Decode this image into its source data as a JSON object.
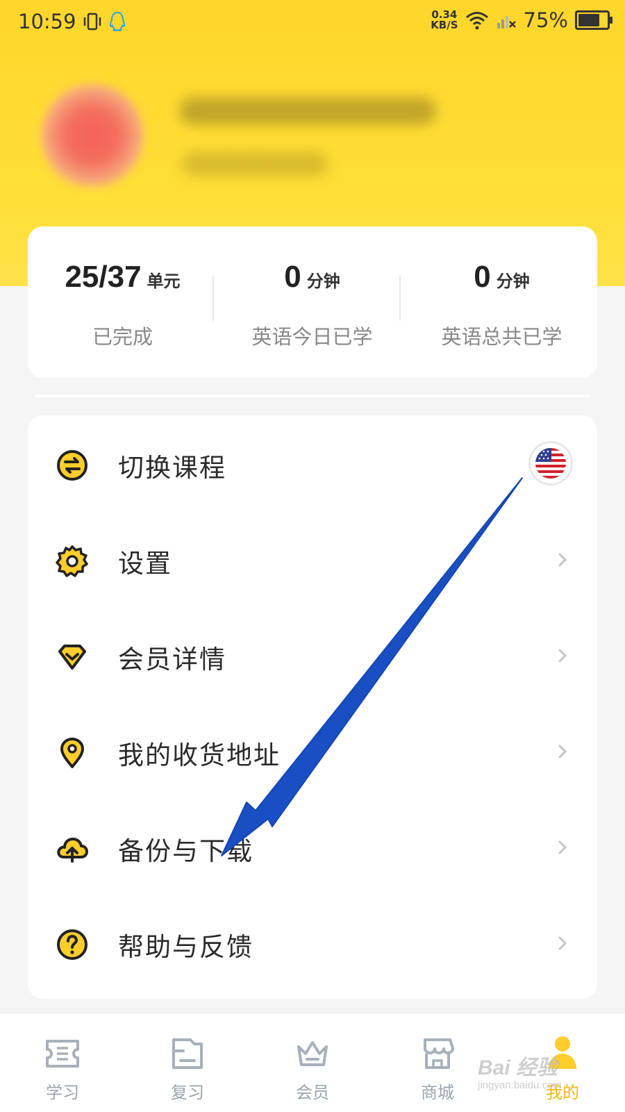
{
  "status_bar": {
    "time": "10:59",
    "net_speed_value": "0.34",
    "net_speed_unit": "KB/S",
    "battery": "75%",
    "battery_level": 0.75
  },
  "stats": [
    {
      "value": "25/37",
      "unit": "单元",
      "label": "已完成"
    },
    {
      "value": "0",
      "unit": "分钟",
      "label": "英语今日已学"
    },
    {
      "value": "0",
      "unit": "分钟",
      "label": "英语总共已学"
    }
  ],
  "menu": [
    {
      "label": "切换课程",
      "icon": "switch-icon",
      "trailing": "us-flag-icon"
    },
    {
      "label": "设置",
      "icon": "gear-icon",
      "trailing": "chevron-right-icon"
    },
    {
      "label": "会员详情",
      "icon": "diamond-icon",
      "trailing": "chevron-right-icon"
    },
    {
      "label": "我的收货地址",
      "icon": "location-pin-icon",
      "trailing": "chevron-right-icon"
    },
    {
      "label": "备份与下载",
      "icon": "cloud-upload-icon",
      "trailing": "chevron-right-icon"
    },
    {
      "label": "帮助与反馈",
      "icon": "question-icon",
      "trailing": "chevron-right-icon"
    }
  ],
  "tabs": [
    {
      "label": "学习",
      "icon": "ticket-icon",
      "active": false
    },
    {
      "label": "复习",
      "icon": "folder-icon",
      "active": false
    },
    {
      "label": "会员",
      "icon": "crown-icon",
      "active": false
    },
    {
      "label": "商城",
      "icon": "store-icon",
      "active": false
    },
    {
      "label": "我的",
      "icon": "person-icon",
      "active": true
    }
  ],
  "watermark": {
    "text": "Bai 经验",
    "sub": "jingyan.baidu.com"
  },
  "colors": {
    "header_yellow": "#ffd62a",
    "icon_yellow": "#ffcd2c",
    "active_tab": "#f3b60f",
    "arrow_blue": "#1a4fc4"
  }
}
